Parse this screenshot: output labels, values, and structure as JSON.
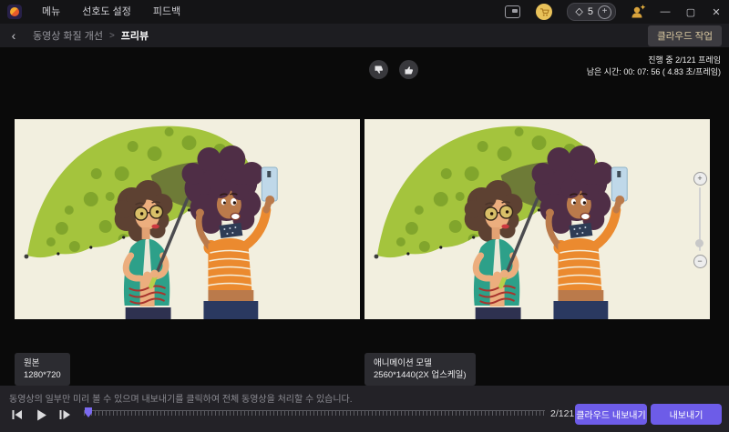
{
  "accent_color": "#6d5ce8",
  "titlebar": {
    "menu_items": [
      "메뉴",
      "선호도 설정",
      "피드백"
    ],
    "credits_count": "5",
    "plus_glyph": "+",
    "window_controls": {
      "minimize": "—",
      "maximize": "▢",
      "close": "✕"
    }
  },
  "breadcrumb": {
    "back_glyph": "‹",
    "parent": "동영상 화질 개선",
    "separator": ">",
    "current": "프리뷰",
    "cloud_task_button": "클라우드 작업"
  },
  "preview": {
    "progress_line1": "진행 중 2/121 프레임",
    "progress_line2": "남은 시간: 00: 07: 56 ( 4.83 초/프레임)",
    "original_label": {
      "title": "원본",
      "resolution": "1280*720"
    },
    "enhanced_label": {
      "title": "애니메이션 모델",
      "resolution": "2560*1440(2X 업스케일)"
    },
    "zoom_slider": {
      "plus": "+",
      "minus": "−"
    },
    "icons": {
      "gem": "◇"
    }
  },
  "footer": {
    "notice": "동영상의 일부만 미리 볼 수 있으며 내보내기를 클릭하여 전체 동영상을 처리할 수 있습니다.",
    "frame_counter": "2/121",
    "cloud_export_button": "클라우드 내보내기",
    "export_button": "내보내기"
  }
}
